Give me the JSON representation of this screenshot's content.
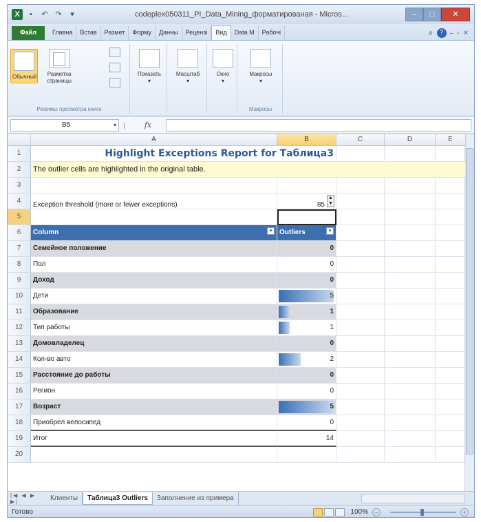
{
  "window": {
    "title": "codeplex050311_PI_Data_Mining_форматированая - Micros..."
  },
  "ribbon": {
    "tabs": [
      "Файл",
      "Главна",
      "Встав",
      "Размет",
      "Форму",
      "Данны",
      "Рецензі",
      "Вид",
      "Data M",
      "Рабочі"
    ],
    "active_tab": "Вид",
    "groups": {
      "views": {
        "label": "Режимы просмотра книги",
        "normal": "Обычный",
        "page_layout": "Разметка страницы"
      },
      "show": {
        "label": "Показать"
      },
      "zoom": {
        "label": "Масштаб"
      },
      "window": {
        "label": "Окно"
      },
      "macros": {
        "label": "Макросы",
        "button": "Макросы"
      }
    }
  },
  "formula_bar": {
    "name_box": "B5",
    "fx": "fx",
    "formula": ""
  },
  "sheet": {
    "columns": [
      "A",
      "B",
      "C",
      "D",
      "E"
    ],
    "selected_column": "B",
    "selected_row": "5",
    "rows": [
      "1",
      "2",
      "3",
      "4",
      "5",
      "6",
      "7",
      "8",
      "9",
      "10",
      "11",
      "12",
      "13",
      "14",
      "15",
      "16",
      "17",
      "18",
      "19",
      "20"
    ],
    "title": "Highlight Exceptions Report for Таблица3",
    "info": "The outlier cells are highlighted in the original table.",
    "threshold_label": "Exception threshold (more or fewer exceptions)",
    "threshold_value": "85",
    "header_column": "Column",
    "header_outliers": "Outliers",
    "items": [
      {
        "label": "Семейное положение",
        "value": "0",
        "bar": 0
      },
      {
        "label": "Пол",
        "value": "0",
        "bar": 0
      },
      {
        "label": "Доход",
        "value": "0",
        "bar": 0
      },
      {
        "label": "Дети",
        "value": "5",
        "bar": 1.0
      },
      {
        "label": "Образование",
        "value": "1",
        "bar": 0.2
      },
      {
        "label": "Тип работы",
        "value": "1",
        "bar": 0.2
      },
      {
        "label": "Домовладелец",
        "value": "0",
        "bar": 0
      },
      {
        "label": "Кол-во авто",
        "value": "2",
        "bar": 0.4
      },
      {
        "label": "Расстояние до работы",
        "value": "0",
        "bar": 0
      },
      {
        "label": "Регион",
        "value": "0",
        "bar": 0
      },
      {
        "label": "Возраст",
        "value": "5",
        "bar": 1.0
      },
      {
        "label": "Приобрел велосипед",
        "value": "0",
        "bar": 0
      }
    ],
    "total_label": "Итог",
    "total_value": "14"
  },
  "sheet_tabs": {
    "tabs": [
      "Клиенты",
      "Таблица3 Outliers",
      "Заполнение из примера"
    ],
    "active": "Таблица3 Outliers"
  },
  "status": {
    "ready": "Готово",
    "zoom": "100%"
  }
}
